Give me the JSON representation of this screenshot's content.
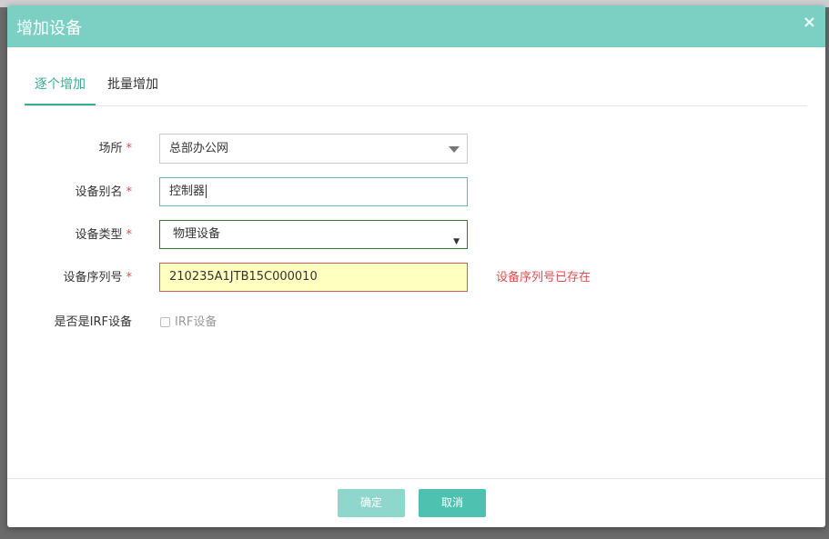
{
  "dialog": {
    "title": "增加设备",
    "close_glyph": "×"
  },
  "tabs": [
    {
      "label": "逐个增加",
      "active": true
    },
    {
      "label": "批量增加",
      "active": false
    }
  ],
  "form": {
    "site": {
      "label": "场所",
      "required_mark": "*",
      "value": "总部办公网"
    },
    "alias": {
      "label": "设备别名",
      "required_mark": "*",
      "value": "控制器"
    },
    "type": {
      "label": "设备类型",
      "required_mark": "*",
      "value": "物理设备",
      "caret": "▼"
    },
    "serial": {
      "label": "设备序列号",
      "required_mark": "*",
      "value": "210235A1JTB15C000010",
      "error": "设备序列号已存在"
    },
    "irf": {
      "label": "是否是IRF设备",
      "checkbox_label": "IRF设备",
      "checked": false
    }
  },
  "footer": {
    "confirm_label": "确定",
    "cancel_label": "取消"
  },
  "colors": {
    "header": "#7ccfc3",
    "accent": "#3aaa94",
    "error": "#e34b4b",
    "serial_field_bg": "#ffffc0",
    "type_field_border": "#2e7d32",
    "alias_field_border": "#5bbfb0"
  }
}
